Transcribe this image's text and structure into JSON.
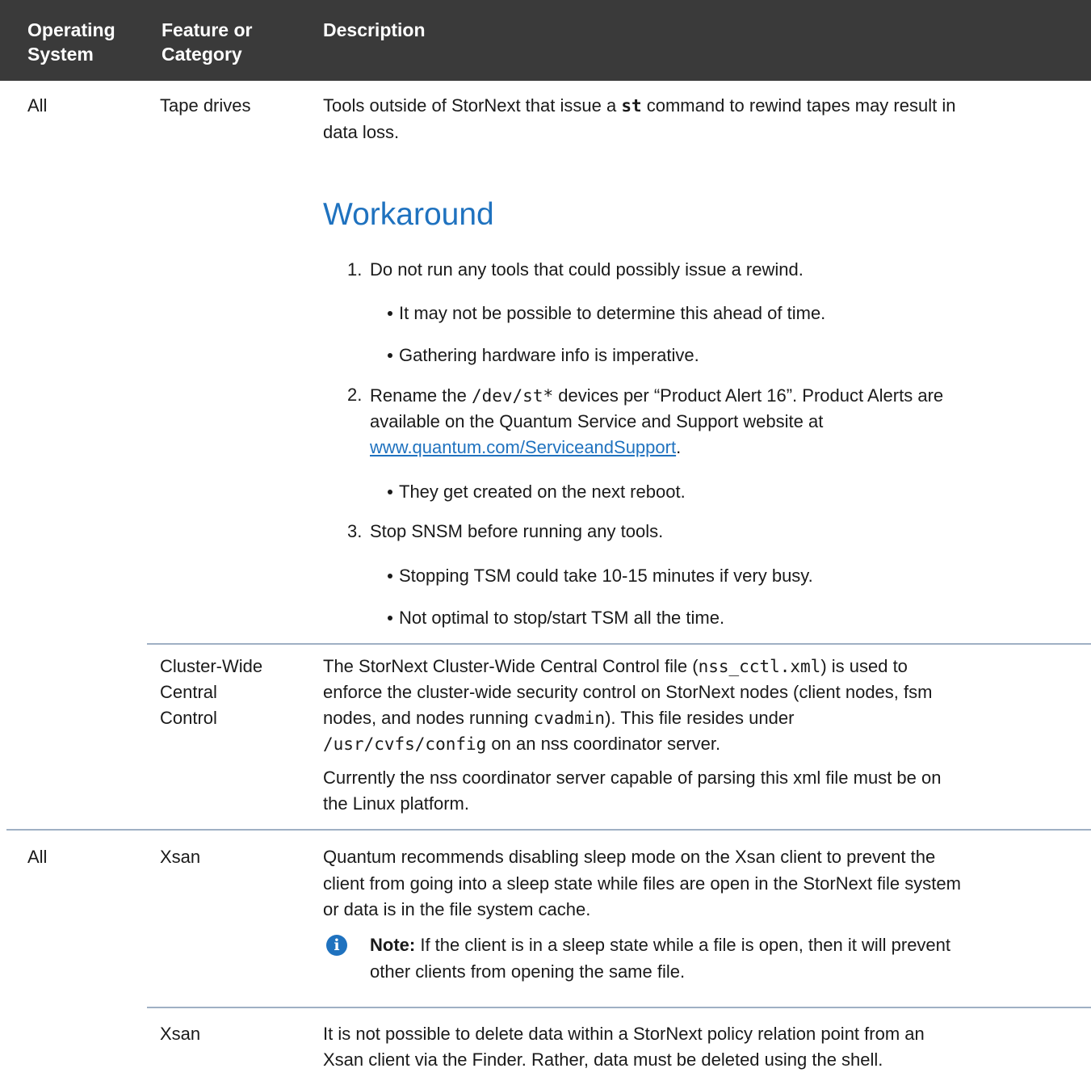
{
  "header": {
    "col1": [
      "Operating",
      "System"
    ],
    "col2": [
      "Feature or",
      "Category"
    ],
    "col3": "Description"
  },
  "rows": {
    "r1": {
      "os": "All",
      "feature": "Tape drives",
      "desc_a": "Tools outside of StorNext that issue a ",
      "desc_code": "st",
      "desc_b": " command to rewind tapes may result in",
      "desc_c": "data loss.",
      "workaround_title": "Workaround",
      "step1_num": "1.",
      "step1": "Do not run any tools that could possibly issue a rewind.",
      "step1_b1": "It may not be possible to determine this ahead of time.",
      "step1_b2": "Gathering hardware info is imperative.",
      "step2_num": "2.",
      "step2_a": "Rename the ",
      "step2_code": "/dev/st*",
      "step2_b": " devices per “Product Alert 16”. Product Alerts are",
      "step2_c": "available on the Quantum Service and Support website at",
      "step2_link": "www.quantum.com/ServiceandSupport",
      "step2_end": ".",
      "step2_b1": "They get created on the next reboot.",
      "step3_num": "3.",
      "step3": "Stop SNSM before running any tools.",
      "step3_b1": "Stopping TSM could take 10-15 minutes if very busy.",
      "step3_b2": "Not optimal to stop/start TSM all the time."
    },
    "r2": {
      "feature": [
        "Cluster-Wide",
        "Central",
        "Control"
      ],
      "l1a": "The StorNext Cluster-Wide Central Control file (",
      "l1code": "nss_cctl.xml",
      "l1b": ") is used to",
      "l2": "enforce the cluster-wide security control on StorNext nodes (client nodes, fsm",
      "l3a": "nodes, and nodes running ",
      "l3code": "cvadmin",
      "l3b": "). This file resides under",
      "l4code": "/usr/cvfs/config",
      "l4b": " on an nss coordinator server.",
      "l5": "Currently the nss coordinator server capable of parsing this xml file must be on",
      "l6": "the Linux platform."
    },
    "r3": {
      "os": "All",
      "feature": "Xsan",
      "l1": "Quantum recommends disabling sleep mode on the Xsan client to prevent the",
      "l2": "client from going into a sleep state while files are open in the StorNext file system",
      "l3": "or data is in the file system cache.",
      "note_label": "Note:",
      "note_a": " If the client is in a sleep state while a file is open, then it will prevent",
      "note_b": "other clients from opening the same file."
    },
    "r4": {
      "feature": "Xsan",
      "l1": "It is not possible to delete data within a StorNext policy relation point from an",
      "l2": "Xsan client via the Finder. Rather, data must be deleted using the shell."
    }
  },
  "icons": {
    "note": "info-icon"
  }
}
